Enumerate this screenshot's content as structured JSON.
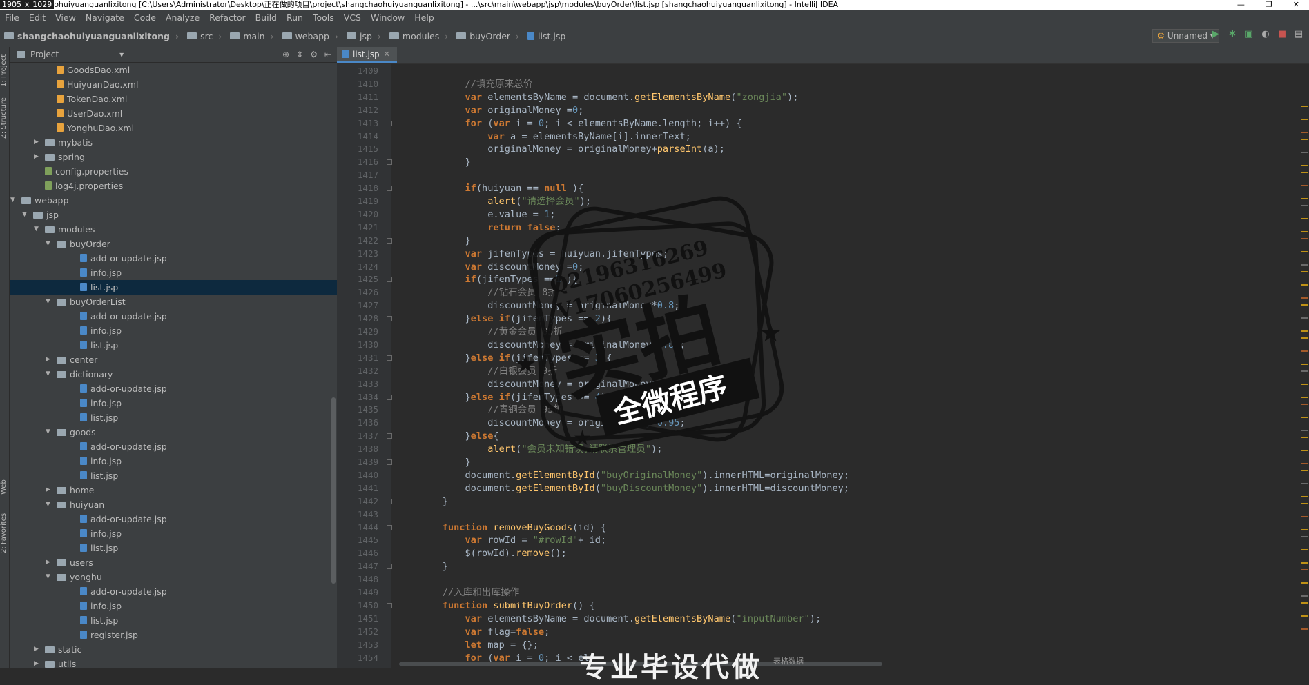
{
  "titlebar": {
    "dims": "1905 × 1029",
    "title": "ohuiyuanguanlixitong [C:\\Users\\Administrator\\Desktop\\正在做的项目\\project\\shangchaohuiyuanguanlixitong] - ...\\src\\main\\webapp\\jsp\\modules\\buyOrder\\list.jsp [shangchaohuiyuanguanlixitong] - IntelliJ IDEA"
  },
  "menu": [
    "File",
    "Edit",
    "View",
    "Navigate",
    "Code",
    "Analyze",
    "Refactor",
    "Build",
    "Run",
    "Tools",
    "VCS",
    "Window",
    "Help"
  ],
  "breadcrumb": [
    "shangchaohuiyuanguanlixitong",
    "src",
    "main",
    "webapp",
    "jsp",
    "modules",
    "buyOrder",
    "list.jsp"
  ],
  "run_config": "Unnamed",
  "side_tabs": {
    "project": "1: Project",
    "structure": "Z: Structure",
    "web": "Web",
    "favorites": "2: Favorites"
  },
  "project_panel": {
    "title": "Project"
  },
  "tree": [
    {
      "label": "GoodsDao.xml",
      "icon": "xml",
      "depth": 6
    },
    {
      "label": "HuiyuanDao.xml",
      "icon": "xml",
      "depth": 6
    },
    {
      "label": "TokenDao.xml",
      "icon": "xml",
      "depth": 6
    },
    {
      "label": "UserDao.xml",
      "icon": "xml",
      "depth": 6
    },
    {
      "label": "YonghuDao.xml",
      "icon": "xml",
      "depth": 6
    },
    {
      "label": "mybatis",
      "icon": "folder",
      "depth": 5,
      "arrow": "closed"
    },
    {
      "label": "spring",
      "icon": "folder",
      "depth": 5,
      "arrow": "closed"
    },
    {
      "label": "config.properties",
      "icon": "props",
      "depth": 5
    },
    {
      "label": "log4j.properties",
      "icon": "props",
      "depth": 5
    },
    {
      "label": "webapp",
      "icon": "folder",
      "depth": 3,
      "arrow": "open"
    },
    {
      "label": "jsp",
      "icon": "folder",
      "depth": 4,
      "arrow": "open"
    },
    {
      "label": "modules",
      "icon": "folder",
      "depth": 5,
      "arrow": "open"
    },
    {
      "label": "buyOrder",
      "icon": "folder",
      "depth": 6,
      "arrow": "open"
    },
    {
      "label": "add-or-update.jsp",
      "icon": "jsp",
      "depth": 8
    },
    {
      "label": "info.jsp",
      "icon": "jsp",
      "depth": 8
    },
    {
      "label": "list.jsp",
      "icon": "jsp",
      "depth": 8,
      "selected": true
    },
    {
      "label": "buyOrderList",
      "icon": "folder",
      "depth": 6,
      "arrow": "open"
    },
    {
      "label": "add-or-update.jsp",
      "icon": "jsp",
      "depth": 8
    },
    {
      "label": "info.jsp",
      "icon": "jsp",
      "depth": 8
    },
    {
      "label": "list.jsp",
      "icon": "jsp",
      "depth": 8
    },
    {
      "label": "center",
      "icon": "folder",
      "depth": 6,
      "arrow": "closed"
    },
    {
      "label": "dictionary",
      "icon": "folder",
      "depth": 6,
      "arrow": "open"
    },
    {
      "label": "add-or-update.jsp",
      "icon": "jsp",
      "depth": 8
    },
    {
      "label": "info.jsp",
      "icon": "jsp",
      "depth": 8
    },
    {
      "label": "list.jsp",
      "icon": "jsp",
      "depth": 8
    },
    {
      "label": "goods",
      "icon": "folder",
      "depth": 6,
      "arrow": "open"
    },
    {
      "label": "add-or-update.jsp",
      "icon": "jsp",
      "depth": 8
    },
    {
      "label": "info.jsp",
      "icon": "jsp",
      "depth": 8
    },
    {
      "label": "list.jsp",
      "icon": "jsp",
      "depth": 8
    },
    {
      "label": "home",
      "icon": "folder",
      "depth": 6,
      "arrow": "closed"
    },
    {
      "label": "huiyuan",
      "icon": "folder",
      "depth": 6,
      "arrow": "open"
    },
    {
      "label": "add-or-update.jsp",
      "icon": "jsp",
      "depth": 8
    },
    {
      "label": "info.jsp",
      "icon": "jsp",
      "depth": 8
    },
    {
      "label": "list.jsp",
      "icon": "jsp",
      "depth": 8
    },
    {
      "label": "users",
      "icon": "folder",
      "depth": 6,
      "arrow": "closed"
    },
    {
      "label": "yonghu",
      "icon": "folder",
      "depth": 6,
      "arrow": "open"
    },
    {
      "label": "add-or-update.jsp",
      "icon": "jsp",
      "depth": 8
    },
    {
      "label": "info.jsp",
      "icon": "jsp",
      "depth": 8
    },
    {
      "label": "list.jsp",
      "icon": "jsp",
      "depth": 8
    },
    {
      "label": "register.jsp",
      "icon": "jsp",
      "depth": 8
    },
    {
      "label": "static",
      "icon": "folder",
      "depth": 5,
      "arrow": "closed"
    },
    {
      "label": "utils",
      "icon": "folder",
      "depth": 5,
      "arrow": "closed"
    }
  ],
  "editor_tab": "list.jsp",
  "code": [
    {
      "n": "1409",
      "t": ""
    },
    {
      "n": "1410",
      "t": "        //填充原来总价"
    },
    {
      "n": "1411",
      "t": "        var elementsByName = document.getElementsByName(\"zongjia\");"
    },
    {
      "n": "1412",
      "t": "        var originalMoney =0;"
    },
    {
      "n": "1413",
      "t": "        for (var i = 0; i < elementsByName.length; i++) {"
    },
    {
      "n": "1414",
      "t": "            var a = elementsByName[i].innerText;"
    },
    {
      "n": "1415",
      "t": "            originalMoney = originalMoney+parseInt(a);"
    },
    {
      "n": "1416",
      "t": "        }"
    },
    {
      "n": "1417",
      "t": ""
    },
    {
      "n": "1418",
      "t": "        if(huiyuan == null ){"
    },
    {
      "n": "1419",
      "t": "            alert(\"请选择会员\");"
    },
    {
      "n": "1420",
      "t": "            e.value = 1;"
    },
    {
      "n": "1421",
      "t": "            return false;"
    },
    {
      "n": "1422",
      "t": "        }"
    },
    {
      "n": "1423",
      "t": "        var jifenTypes = huiyuan.jifenTypes;"
    },
    {
      "n": "1424",
      "t": "        var discountMoney =0;"
    },
    {
      "n": "1425",
      "t": "        if(jifenTypes ==1 ){"
    },
    {
      "n": "1426",
      "t": "            //钻石会员 8折"
    },
    {
      "n": "1427",
      "t": "            discountMoney = originalMoney*0.8;"
    },
    {
      "n": "1428",
      "t": "        }else if(jifenTypes == 2){"
    },
    {
      "n": "1429",
      "t": "            //黄金会员 85折"
    },
    {
      "n": "1430",
      "t": "            discountMoney = originalMoney*0.85;"
    },
    {
      "n": "1431",
      "t": "        }else if(jifenTypes == 3){"
    },
    {
      "n": "1432",
      "t": "            //白银会员 9折"
    },
    {
      "n": "1433",
      "t": "            discountMoney = originalMoney*0.90;"
    },
    {
      "n": "1434",
      "t": "        }else if(jifenTypes == 4){"
    },
    {
      "n": "1435",
      "t": "            //青铜会员 95折"
    },
    {
      "n": "1436",
      "t": "            discountMoney = originalMoney*0.95;"
    },
    {
      "n": "1437",
      "t": "        }else{"
    },
    {
      "n": "1438",
      "t": "            alert(\"会员未知错误,请联系管理员\");"
    },
    {
      "n": "1439",
      "t": "        }"
    },
    {
      "n": "1440",
      "t": "        document.getElementById(\"buyOriginalMoney\").innerHTML=originalMoney;"
    },
    {
      "n": "1441",
      "t": "        document.getElementById(\"buyDiscountMoney\").innerHTML=discountMoney;"
    },
    {
      "n": "1442",
      "t": "    }"
    },
    {
      "n": "1443",
      "t": ""
    },
    {
      "n": "1444",
      "t": "    function removeBuyGoods(id) {"
    },
    {
      "n": "1445",
      "t": "        var rowId = \"#rowId\"+ id;"
    },
    {
      "n": "1446",
      "t": "        $(rowId).remove();"
    },
    {
      "n": "1447",
      "t": "    }"
    },
    {
      "n": "1448",
      "t": ""
    },
    {
      "n": "1449",
      "t": "    //入库和出库操作"
    },
    {
      "n": "1450",
      "t": "    function submitBuyOrder() {"
    },
    {
      "n": "1451",
      "t": "        var elementsByName = document.getElementsByName(\"inputNumber\");"
    },
    {
      "n": "1452",
      "t": "        var flag=false;"
    },
    {
      "n": "1453",
      "t": "        let map = {};"
    },
    {
      "n": "1454",
      "t": "        for (var i = 0; i < el"
    }
  ],
  "watermark": {
    "qq": "Q2196316269",
    "vx": "V17060256499",
    "big": "实拍",
    "banner": "全微程序"
  },
  "subtitle": "专业毕设代做",
  "subtitle_small": "表格数据"
}
